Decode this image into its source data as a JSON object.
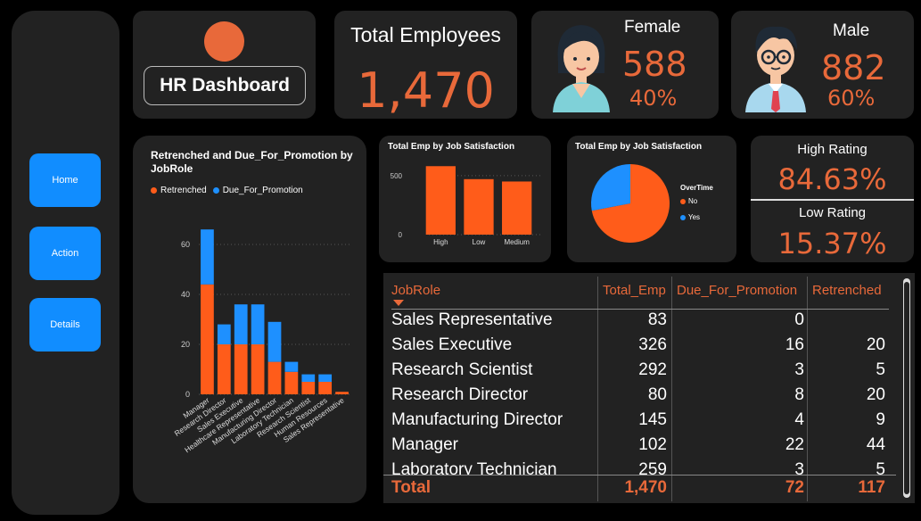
{
  "nav": {
    "home": "Home",
    "action": "Action",
    "details": "Details"
  },
  "title": "HR Dashboard",
  "kpi": {
    "total_label": "Total Employees",
    "total_value": "1,470",
    "female_label": "Female",
    "female_value": "588",
    "female_pct": "40%",
    "male_label": "Male",
    "male_value": "882",
    "male_pct": "60%"
  },
  "rating": {
    "high_label": "High Rating",
    "high_value": "84.63%",
    "low_label": "Low Rating",
    "low_value": "15.37%"
  },
  "colors": {
    "orange": "#FF5C1A",
    "blue": "#1E90FF",
    "accent": "#E8693A",
    "card": "#222222"
  },
  "chart_data": [
    {
      "type": "bar",
      "stacked": true,
      "title": "Retrenched and Due_For_Promotion by JobRole",
      "legend": "top-left",
      "categories": [
        "Manager",
        "Research Director",
        "Sales Executive",
        "Healthcare Representative",
        "Manufacturing Director",
        "Laboratory Technician",
        "Research Scientist",
        "Human Resources",
        "Sales Representative"
      ],
      "series": [
        {
          "name": "Retrenched",
          "values": [
            44,
            20,
            20,
            20,
            13,
            9,
            5,
            5,
            1
          ],
          "color": "#FF5C1A"
        },
        {
          "name": "Due_For_Promotion",
          "values": [
            22,
            8,
            16,
            16,
            16,
            4,
            3,
            3,
            0
          ],
          "color": "#1E90FF"
        }
      ],
      "yticks": [
        0,
        20,
        40,
        60
      ],
      "ylim": [
        0,
        70
      ]
    },
    {
      "type": "bar",
      "title": "Total Emp by Job Satisfaction",
      "categories": [
        "High",
        "Low",
        "Medium"
      ],
      "values": [
        580,
        470,
        450
      ],
      "yticks": [
        0,
        500
      ],
      "ylim": [
        0,
        650
      ],
      "color": "#FF5C1A"
    },
    {
      "type": "pie",
      "title": "Total Emp by Job Satisfaction",
      "legend_title": "OverTime",
      "legend": "right",
      "labels": [
        "No",
        "Yes"
      ],
      "values": [
        72,
        28
      ],
      "colors": [
        "#FF5C1A",
        "#1E90FF"
      ]
    }
  ],
  "table": {
    "headers": [
      "JobRole",
      "Total_Emp",
      "Due_For_Promotion",
      "Retrenched"
    ],
    "rows": [
      [
        "Sales Representative",
        "83",
        "0",
        ""
      ],
      [
        "Sales Executive",
        "326",
        "16",
        "20"
      ],
      [
        "Research Scientist",
        "292",
        "3",
        "5"
      ],
      [
        "Research Director",
        "80",
        "8",
        "20"
      ],
      [
        "Manufacturing Director",
        "145",
        "4",
        "9"
      ],
      [
        "Manager",
        "102",
        "22",
        "44"
      ],
      [
        "Laboratory Technician",
        "259",
        "3",
        "5"
      ]
    ],
    "total": [
      "Total",
      "1,470",
      "72",
      "117"
    ]
  }
}
